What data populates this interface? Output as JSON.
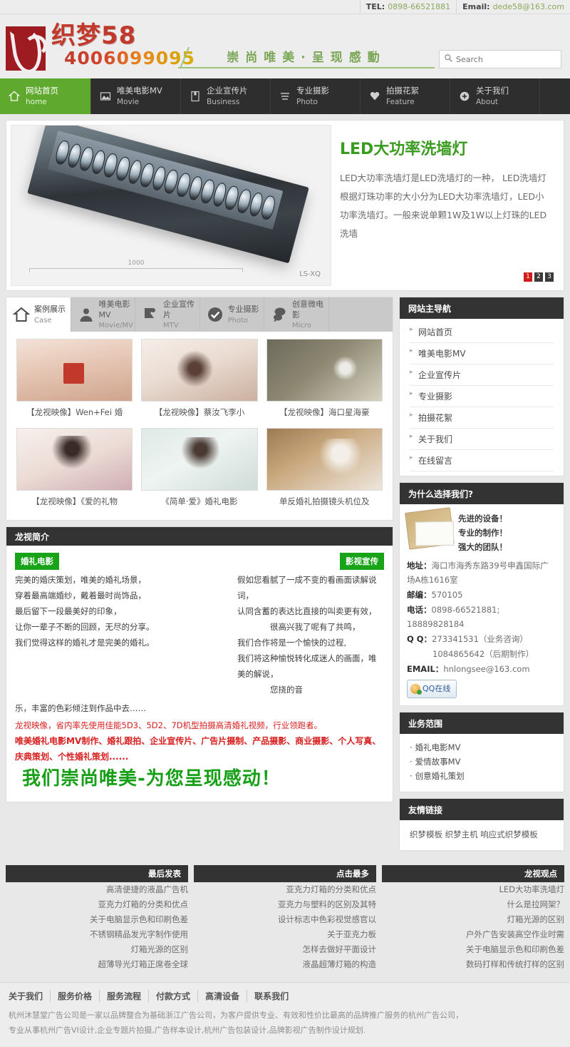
{
  "topbar": {
    "tel_label": "TEL:",
    "tel_value": "0898-66521881",
    "email_label": "Email:",
    "email_value": "dede58@163.com"
  },
  "header": {
    "logo_name": "织梦58",
    "logo_phone": "4006099095",
    "slogan": "崇尚唯美·呈现感動",
    "search_placeholder": "Search",
    "search_value": ""
  },
  "mainnav": [
    {
      "cn": "网站首页",
      "en": "home",
      "icon": "home-icon",
      "active": true
    },
    {
      "cn": "唯美电影MV",
      "en": "Movie",
      "icon": "image-icon",
      "active": false
    },
    {
      "cn": "企业宣传片",
      "en": "Business",
      "icon": "book-icon",
      "active": false
    },
    {
      "cn": "专业摄影",
      "en": "Photo",
      "icon": "list-icon",
      "active": false
    },
    {
      "cn": "拍摄花絮",
      "en": "Feature",
      "icon": "heart-icon",
      "active": false
    },
    {
      "cn": "关于我们",
      "en": "About",
      "icon": "plus-circle-icon",
      "active": false
    }
  ],
  "banner": {
    "title": "LED大功率洗墙灯",
    "desc": "LED大功率洗墙灯是LED洗墙灯的一种， LED洗墙灯根据灯珠功率的大小分为LED大功率洗墙灯，LED小功率洗墙灯。一般来说单颗1W及1W以上灯珠的LED洗墙",
    "scale_label": "1000",
    "product_code": "LS-XQ",
    "dots": [
      "1",
      "2",
      "3"
    ],
    "active_dot": 0
  },
  "case_tabs": [
    {
      "cn": "案例展示",
      "en": "Case",
      "icon": "home-icon",
      "active": true
    },
    {
      "cn": "唯美电影MV",
      "en": "Movie/MV",
      "icon": "user-icon",
      "active": false
    },
    {
      "cn": "企业宣传片",
      "en": "MTV",
      "icon": "pin-icon",
      "active": false
    },
    {
      "cn": "专业摄影",
      "en": "Photo",
      "icon": "check-circle-icon",
      "active": false
    },
    {
      "cn": "创意微电影",
      "en": "Micro",
      "icon": "comment-icon",
      "active": false
    }
  ],
  "gallery": [
    {
      "caption": "【龙视映像】Wen+Fei 婚"
    },
    {
      "caption": "【龙视映像】蔡汝飞李小"
    },
    {
      "caption": "【龙视映像】海口星海豪"
    },
    {
      "caption": "【龙视映像】《爱的礼物"
    },
    {
      "caption": "《简单·爱》婚礼电影"
    },
    {
      "caption": "单反婚礼拍摄镜头机位及"
    }
  ],
  "intro": {
    "head": "龙视简介",
    "left_tag": "婚礼电影",
    "right_tag": "影视宣传",
    "left_lines": [
      "完美的婚庆策划，唯美的婚礼场景，",
      "穿着最高端婚纱，戴着最时尚饰品，",
      "最后留下一段最美好的印象，",
      "让你一辈子不断的回顾，无尽的分享。",
      "我们觉得这样的婚礼才是完美的婚礼。"
    ],
    "right_lines": [
      "假如您看腻了一成不变的看画面读解说词，",
      "认同含蓄的表达比直接的叫卖更有效，",
      "很高兴我了呢有了共鸣，",
      "我们合作将是一个愉快的过程,",
      "我们将这种愉悦转化成迷人的画面，唯美的解说，",
      "您挠的音"
    ],
    "tail_line": "乐，丰富的色彩倾注到作品中去……",
    "red_line": "龙视映像，省内率先使用佳能5D3、5D2、7D机型拍摄高清婚礼视频，行业领跑者。",
    "red_bold_line": "唯美婚礼电影MV制作、婚礼跟拍、企业宣传片、广告片摄制、产品摄影、商业摄影、个人写真、庆典策划、个性婚礼策划......",
    "green_slogan": "我们崇尚唯美-为您呈现感动！"
  },
  "sidebar": {
    "nav_head": "网站主导航",
    "nav_items": [
      "网站首页",
      "唯美电影MV",
      "企业宣传片",
      "专业摄影",
      "拍摄花絮",
      "关于我们",
      "在线留言"
    ],
    "why_head": "为什么选择我们?",
    "why_slogans": [
      "先进的设备！",
      "专业的制作！",
      "强大的团队！"
    ],
    "contacts": [
      {
        "label": "地址：",
        "value": "海口市海秀东路39号申鑫国际广场A栋1616室"
      },
      {
        "label": "邮编：",
        "value": "570105"
      },
      {
        "label": "电话：",
        "value": "0898-66521881; 18889828184"
      },
      {
        "label": "Q Q：",
        "value": "273341531（业务咨询）"
      },
      {
        "label": "",
        "value": "1084865642（后期制作）"
      },
      {
        "label": "EMAIL：",
        "value": "hnlongsee@163.com"
      }
    ],
    "qq_button": "QQ在线",
    "biz_head": "业务范围",
    "biz_items": [
      "婚礼电影MV",
      "爱情故事MV",
      "创意婚礼策划"
    ],
    "links_head": "友情链接",
    "links_text": "织梦模板 织梦主机 响应式织梦模板"
  },
  "footer_cols": [
    {
      "head": "最后发表",
      "items": [
        "高清便捷的液晶广告机",
        "亚克力灯箱的分类和优点",
        "关于电脑显示色和印刷色差",
        "不锈钢精品发光字制作使用",
        "灯箱光源的区别",
        "超薄导光灯箱正席卷全球"
      ]
    },
    {
      "head": "点击最多",
      "items": [
        "亚克力灯箱的分类和优点",
        "亚克力与塑料的区别及其特",
        "设计标志中色彩视觉感官以",
        "关于亚克力板",
        "怎样去做好平面设计",
        "液晶超薄灯箱的构造"
      ]
    },
    {
      "head": "龙视观点",
      "items": [
        "LED大功率洗墙灯",
        "什么是拉网架？",
        "灯箱光源的区别",
        "户外广告安装高空作业时需",
        "关于电脑显示色和印刷色差",
        "数码打样和传统打样的区别"
      ]
    }
  ],
  "bottom": {
    "nav": [
      "关于我们",
      "服务价格",
      "服务流程",
      "付款方式",
      "高清设备",
      "联系我们"
    ],
    "text_line1": "杭州沐慧堂广告公司是一家以品牌整合为基础浙江广告公司，为客户提供专业、有效和性价比最高的品牌推广服务的杭州广告公司，",
    "text_line2": "专业从事杭州广告VI设计,企业专题片拍摄,广告样本设计,杭州广告包装设计,品牌影视广告制作设计规划."
  }
}
